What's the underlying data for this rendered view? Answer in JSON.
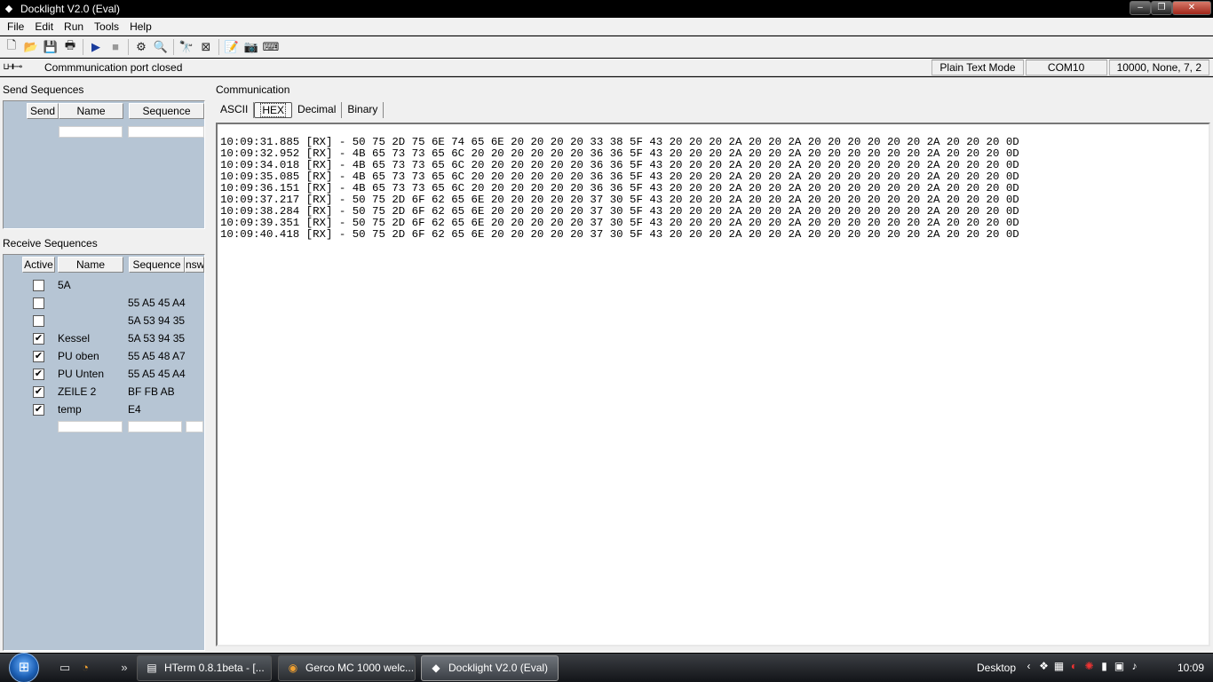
{
  "window": {
    "title": "Docklight V2.0 (Eval)",
    "min": "‒",
    "max": "❐",
    "close": "✕"
  },
  "menu": [
    "File",
    "Edit",
    "Run",
    "Tools",
    "Help"
  ],
  "status": {
    "port_icon": "⊔⊣⊢⊸",
    "port_text": "Commmunication port closed",
    "mode": "Plain Text Mode",
    "port": "COM10",
    "settings": "10000, None, 7, 2"
  },
  "send": {
    "title": "Send Sequences",
    "headers": {
      "send": "Send",
      "name": "Name",
      "sequence": "Sequence"
    }
  },
  "receive": {
    "title": "Receive Sequences",
    "headers": {
      "active": "Active",
      "name": "Name",
      "sequence": "Sequence",
      "answer": "nsw"
    },
    "rows": [
      {
        "checked": "",
        "name": "5A",
        "sequence": ""
      },
      {
        "checked": "",
        "name": "",
        "sequence": "55 A5 45 A4"
      },
      {
        "checked": "",
        "name": "",
        "sequence": "5A 53 94 35"
      },
      {
        "checked": "✔",
        "name": "Kessel",
        "sequence": "5A 53 94 35"
      },
      {
        "checked": "✔",
        "name": "PU oben",
        "sequence": "55 A5 48 A7"
      },
      {
        "checked": "✔",
        "name": "PU Unten",
        "sequence": "55 A5 45 A4"
      },
      {
        "checked": "✔",
        "name": "ZEILE 2",
        "sequence": "BF FB AB"
      },
      {
        "checked": "✔",
        "name": "temp",
        "sequence": "E4"
      }
    ]
  },
  "comm": {
    "title": "Communication",
    "tabs": [
      "ASCII",
      "HEX",
      "Decimal",
      "Binary"
    ],
    "active_tab": "HEX",
    "lines": [
      "10:09:31.885 [RX] - 50 75 2D 75 6E 74 65 6E 20 20 20 20 33 38 5F 43 20 20 20 2A 20 20 2A 20 20 20 20 20 20 2A 20 20 20 0D",
      "10:09:32.952 [RX] - 4B 65 73 73 65 6C 20 20 20 20 20 20 36 36 5F 43 20 20 20 2A 20 20 2A 20 20 20 20 20 20 2A 20 20 20 0D",
      "10:09:34.018 [RX] - 4B 65 73 73 65 6C 20 20 20 20 20 20 36 36 5F 43 20 20 20 2A 20 20 2A 20 20 20 20 20 20 2A 20 20 20 0D",
      "10:09:35.085 [RX] - 4B 65 73 73 65 6C 20 20 20 20 20 20 36 36 5F 43 20 20 20 2A 20 20 2A 20 20 20 20 20 20 2A 20 20 20 0D",
      "10:09:36.151 [RX] - 4B 65 73 73 65 6C 20 20 20 20 20 20 36 36 5F 43 20 20 20 2A 20 20 2A 20 20 20 20 20 20 2A 20 20 20 0D",
      "10:09:37.217 [RX] - 50 75 2D 6F 62 65 6E 20 20 20 20 20 37 30 5F 43 20 20 20 2A 20 20 2A 20 20 20 20 20 20 2A 20 20 20 0D",
      "10:09:38.284 [RX] - 50 75 2D 6F 62 65 6E 20 20 20 20 20 37 30 5F 43 20 20 20 2A 20 20 2A 20 20 20 20 20 20 2A 20 20 20 0D",
      "10:09:39.351 [RX] - 50 75 2D 6F 62 65 6E 20 20 20 20 20 37 30 5F 43 20 20 20 2A 20 20 2A 20 20 20 20 20 20 2A 20 20 20 0D",
      "10:09:40.418 [RX] - 50 75 2D 6F 62 65 6E 20 20 20 20 20 37 30 5F 43 20 20 20 2A 20 20 2A 20 20 20 20 20 20 2A 20 20 20 0D"
    ]
  },
  "taskbar": {
    "start_glyph": "⊞",
    "overflow": "»",
    "tasks": [
      {
        "icon": "▤",
        "label": "HTerm 0.8.1beta - [..."
      },
      {
        "icon": "◉",
        "label": "Gerco MC 1000 welc..."
      },
      {
        "icon": "◆",
        "label": "Docklight V2.0 (Eval)"
      }
    ],
    "desktop": "Desktop",
    "clock": "10:09"
  },
  "colors": {
    "panel": "#b6c5d4",
    "titlebar": "#000000",
    "taskbar": "#1e2024"
  }
}
